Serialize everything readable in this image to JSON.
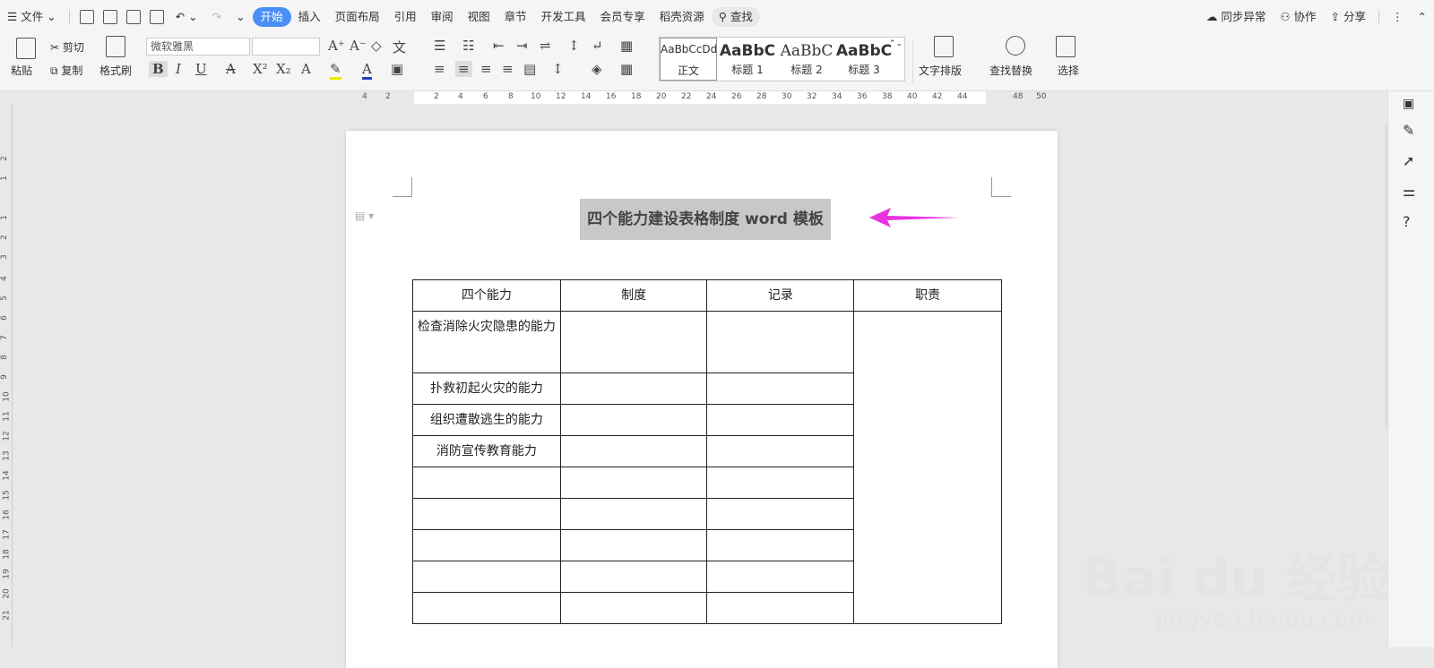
{
  "menubar": {
    "file_label": "文件",
    "tabs": [
      "开始",
      "插入",
      "页面布局",
      "引用",
      "审阅",
      "视图",
      "章节",
      "开发工具",
      "会员专享",
      "稻壳资源"
    ],
    "search_label": "查找",
    "sync_label": "同步异常",
    "collab_label": "协作",
    "share_label": "分享"
  },
  "ribbon": {
    "paste": "粘贴",
    "cut": "剪切",
    "copy": "复制",
    "format_painter": "格式刷",
    "font_name": "微软雅黑",
    "font_size": "",
    "styles": [
      {
        "preview": "AaBbCcDd",
        "label": "正文"
      },
      {
        "preview": "AaBbC",
        "label": "标题 1"
      },
      {
        "preview": "AaBbC",
        "label": "标题 2"
      },
      {
        "preview": "AaBbC",
        "label": "标题 3"
      }
    ],
    "text_layout": "文字排版",
    "find_replace": "查找替换",
    "select": "选择"
  },
  "ruler": {
    "h_ticks": [
      "4",
      "2",
      "2",
      "4",
      "6",
      "8",
      "10",
      "12",
      "14",
      "16",
      "18",
      "20",
      "22",
      "24",
      "26",
      "28",
      "30",
      "32",
      "34",
      "36",
      "38",
      "40",
      "42",
      "44",
      "48",
      "50"
    ],
    "v_ticks": [
      "2",
      "1",
      "1",
      "2",
      "3",
      "4",
      "5",
      "6",
      "7",
      "8",
      "9",
      "10",
      "11",
      "12",
      "13",
      "14",
      "15",
      "16",
      "17",
      "18",
      "19",
      "20",
      "21"
    ]
  },
  "document": {
    "title": "四个能力建设表格制度 word 模板",
    "table": {
      "headers": [
        "四个能力",
        "制度",
        "记录",
        "职责"
      ],
      "rows": [
        [
          "检查消除火灾隐患的能力",
          "",
          ""
        ],
        [
          "扑救初起火灾的能力",
          "",
          ""
        ],
        [
          "组织遭散逃生的能力",
          "",
          ""
        ],
        [
          "消防宣传教育能力",
          "",
          ""
        ],
        [
          "",
          "",
          ""
        ],
        [
          "",
          "",
          ""
        ],
        [
          "",
          "",
          ""
        ],
        [
          "",
          "",
          ""
        ],
        [
          "",
          "",
          ""
        ]
      ]
    }
  },
  "watermark": {
    "brand": "Bai du 经验",
    "url": "jingyan.baidu.com"
  },
  "colors": {
    "accent": "#4a8ff7",
    "arrow": "#e834e0",
    "title_highlight": "#c8c8c8"
  }
}
